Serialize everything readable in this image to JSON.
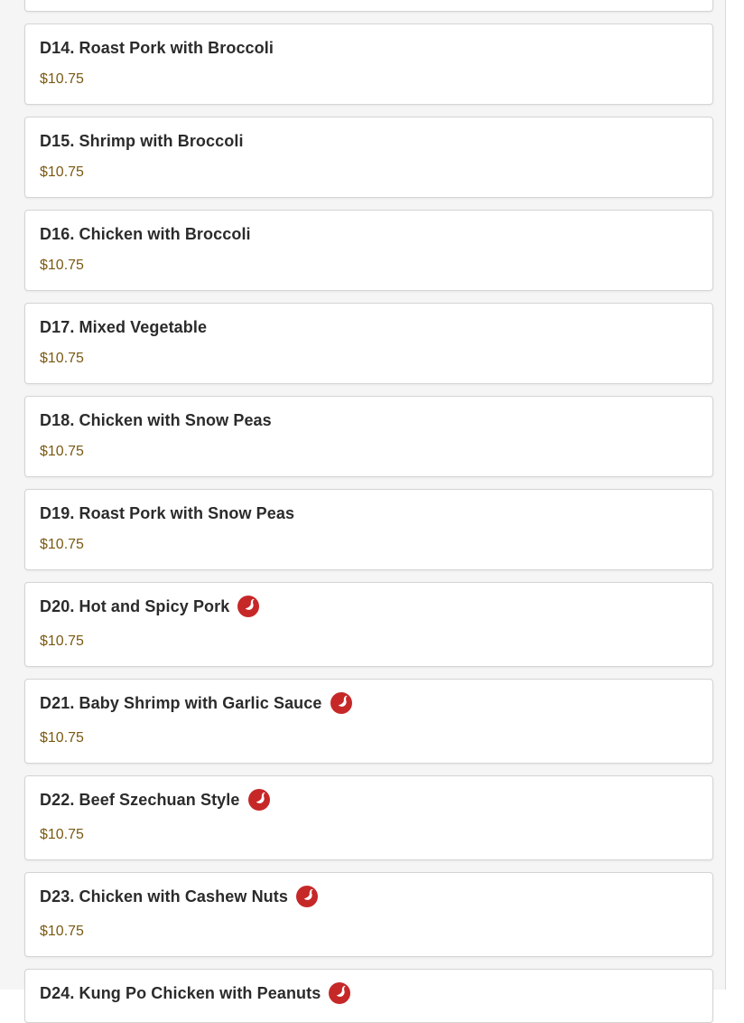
{
  "spicy_icon_color": "#c62828",
  "price_color": "#7a5a12",
  "menu_items": [
    {
      "name": "D14. Roast Pork with Broccoli",
      "price": "$10.75",
      "spicy": false
    },
    {
      "name": "D15. Shrimp with Broccoli",
      "price": "$10.75",
      "spicy": false
    },
    {
      "name": "D16. Chicken with Broccoli",
      "price": "$10.75",
      "spicy": false
    },
    {
      "name": "D17. Mixed Vegetable",
      "price": "$10.75",
      "spicy": false
    },
    {
      "name": "D18. Chicken with Snow Peas",
      "price": "$10.75",
      "spicy": false
    },
    {
      "name": "D19. Roast Pork with Snow Peas",
      "price": "$10.75",
      "spicy": false
    },
    {
      "name": "D20. Hot and Spicy Pork",
      "price": "$10.75",
      "spicy": true
    },
    {
      "name": "D21. Baby Shrimp with Garlic Sauce",
      "price": "$10.75",
      "spicy": true
    },
    {
      "name": "D22. Beef Szechuan Style",
      "price": "$10.75",
      "spicy": true
    },
    {
      "name": "D23. Chicken with Cashew Nuts",
      "price": "$10.75",
      "spicy": true
    },
    {
      "name": "D24. Kung Po Chicken with Peanuts",
      "price": "",
      "spicy": true
    }
  ]
}
